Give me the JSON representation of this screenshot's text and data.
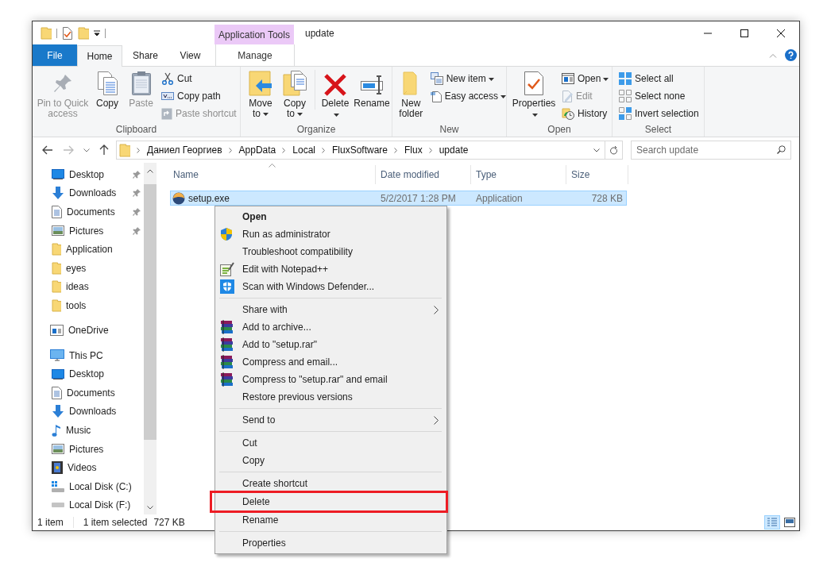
{
  "window": {
    "title": "update",
    "context_tab": "Application Tools"
  },
  "ribbon_tabs": [
    {
      "label": "File",
      "kind": "file",
      "selected": false
    },
    {
      "label": "Home",
      "kind": "tab",
      "selected": true
    },
    {
      "label": "Share",
      "kind": "tab",
      "selected": false
    },
    {
      "label": "View",
      "kind": "tab",
      "selected": false
    },
    {
      "label": "Manage",
      "kind": "contextual",
      "selected": false
    }
  ],
  "ribbon_groups": [
    {
      "label": "Clipboard",
      "large": [
        {
          "label": "Pin to Quick access",
          "disabled": true,
          "dropdown": false
        },
        {
          "label": "Copy",
          "disabled": false,
          "dropdown": false
        },
        {
          "label": "Paste",
          "disabled": true,
          "dropdown": false
        }
      ],
      "small": [
        {
          "label": "Cut",
          "disabled": false,
          "dropdown": false
        },
        {
          "label": "Copy path",
          "disabled": false,
          "dropdown": false
        },
        {
          "label": "Paste shortcut",
          "disabled": true,
          "dropdown": false
        }
      ]
    },
    {
      "label": "Organize",
      "large": [
        {
          "label": "Move to",
          "disabled": false,
          "dropdown": true
        },
        {
          "label": "Copy to",
          "disabled": false,
          "dropdown": true
        },
        {
          "label": "Delete",
          "disabled": false,
          "dropdown": true
        },
        {
          "label": "Rename",
          "disabled": false,
          "dropdown": false
        }
      ]
    },
    {
      "label": "New",
      "large": [
        {
          "label": "New folder",
          "disabled": false,
          "dropdown": false
        }
      ],
      "small": [
        {
          "label": "New item",
          "disabled": false,
          "dropdown": true
        },
        {
          "label": "Easy access",
          "disabled": false,
          "dropdown": true
        }
      ]
    },
    {
      "label": "Open",
      "large": [
        {
          "label": "Properties",
          "disabled": false,
          "dropdown": true
        }
      ],
      "small": [
        {
          "label": "Open",
          "disabled": false,
          "dropdown": true
        },
        {
          "label": "Edit",
          "disabled": true,
          "dropdown": false
        },
        {
          "label": "History",
          "disabled": false,
          "dropdown": false
        }
      ]
    },
    {
      "label": "Select",
      "small": [
        {
          "label": "Select all",
          "disabled": false,
          "dropdown": false
        },
        {
          "label": "Select none",
          "disabled": false,
          "dropdown": false
        },
        {
          "label": "Invert selection",
          "disabled": false,
          "dropdown": false
        }
      ]
    }
  ],
  "breadcrumbs": [
    "Даниел Георгиев",
    "AppData",
    "Local",
    "FluxSoftware",
    "Flux",
    "update"
  ],
  "search": {
    "placeholder": "Search update"
  },
  "navigation": {
    "quick_access": [
      {
        "label": "Desktop",
        "pinned": true
      },
      {
        "label": "Downloads",
        "pinned": true
      },
      {
        "label": "Documents",
        "pinned": true
      },
      {
        "label": "Pictures",
        "pinned": true
      },
      {
        "label": "Application",
        "pinned": false
      },
      {
        "label": "eyes",
        "pinned": false
      },
      {
        "label": "ideas",
        "pinned": false
      },
      {
        "label": "tools",
        "pinned": false
      }
    ],
    "roots": [
      {
        "label": "OneDrive"
      },
      {
        "label": "This PC",
        "children": [
          {
            "label": "Desktop"
          },
          {
            "label": "Documents"
          },
          {
            "label": "Downloads"
          },
          {
            "label": "Music"
          },
          {
            "label": "Pictures"
          },
          {
            "label": "Videos"
          },
          {
            "label": "Local Disk (C:)"
          },
          {
            "label": "Local Disk (F:)"
          }
        ]
      }
    ]
  },
  "file_list": {
    "columns": [
      "Name",
      "Date modified",
      "Type",
      "Size"
    ],
    "rows": [
      {
        "name": "setup.exe",
        "date_modified": "5/2/2017 1:28 PM",
        "type": "Application",
        "size": "728 KB",
        "selected": true
      }
    ]
  },
  "status_bar": {
    "item_count": "1 item",
    "selection": "1 item selected",
    "selection_size": "727 KB"
  },
  "context_menu": [
    {
      "kind": "item",
      "label": "Open",
      "default": true,
      "submenu": false,
      "highlighted": false
    },
    {
      "kind": "item",
      "label": "Run as administrator",
      "default": false,
      "submenu": false,
      "highlighted": false
    },
    {
      "kind": "item",
      "label": "Troubleshoot compatibility",
      "default": false,
      "submenu": false,
      "highlighted": false
    },
    {
      "kind": "item",
      "label": "Edit with Notepad++",
      "default": false,
      "submenu": false,
      "highlighted": false
    },
    {
      "kind": "item",
      "label": "Scan with Windows Defender...",
      "default": false,
      "submenu": false,
      "highlighted": false
    },
    {
      "kind": "separator"
    },
    {
      "kind": "item",
      "label": "Share with",
      "default": false,
      "submenu": true,
      "highlighted": false
    },
    {
      "kind": "item",
      "label": "Add to archive...",
      "default": false,
      "submenu": false,
      "highlighted": false
    },
    {
      "kind": "item",
      "label": "Add to \"setup.rar\"",
      "default": false,
      "submenu": false,
      "highlighted": false
    },
    {
      "kind": "item",
      "label": "Compress and email...",
      "default": false,
      "submenu": false,
      "highlighted": false
    },
    {
      "kind": "item",
      "label": "Compress to \"setup.rar\" and email",
      "default": false,
      "submenu": false,
      "highlighted": false
    },
    {
      "kind": "item",
      "label": "Restore previous versions",
      "default": false,
      "submenu": false,
      "highlighted": false
    },
    {
      "kind": "separator"
    },
    {
      "kind": "item",
      "label": "Send to",
      "default": false,
      "submenu": true,
      "highlighted": false
    },
    {
      "kind": "separator"
    },
    {
      "kind": "item",
      "label": "Cut",
      "default": false,
      "submenu": false,
      "highlighted": false
    },
    {
      "kind": "item",
      "label": "Copy",
      "default": false,
      "submenu": false,
      "highlighted": false
    },
    {
      "kind": "separator"
    },
    {
      "kind": "item",
      "label": "Create shortcut",
      "default": false,
      "submenu": false,
      "highlighted": false
    },
    {
      "kind": "item",
      "label": "Delete",
      "default": false,
      "submenu": false,
      "highlighted": true
    },
    {
      "kind": "item",
      "label": "Rename",
      "default": false,
      "submenu": false,
      "highlighted": false
    },
    {
      "kind": "separator"
    },
    {
      "kind": "item",
      "label": "Properties",
      "default": false,
      "submenu": false,
      "highlighted": false
    }
  ]
}
